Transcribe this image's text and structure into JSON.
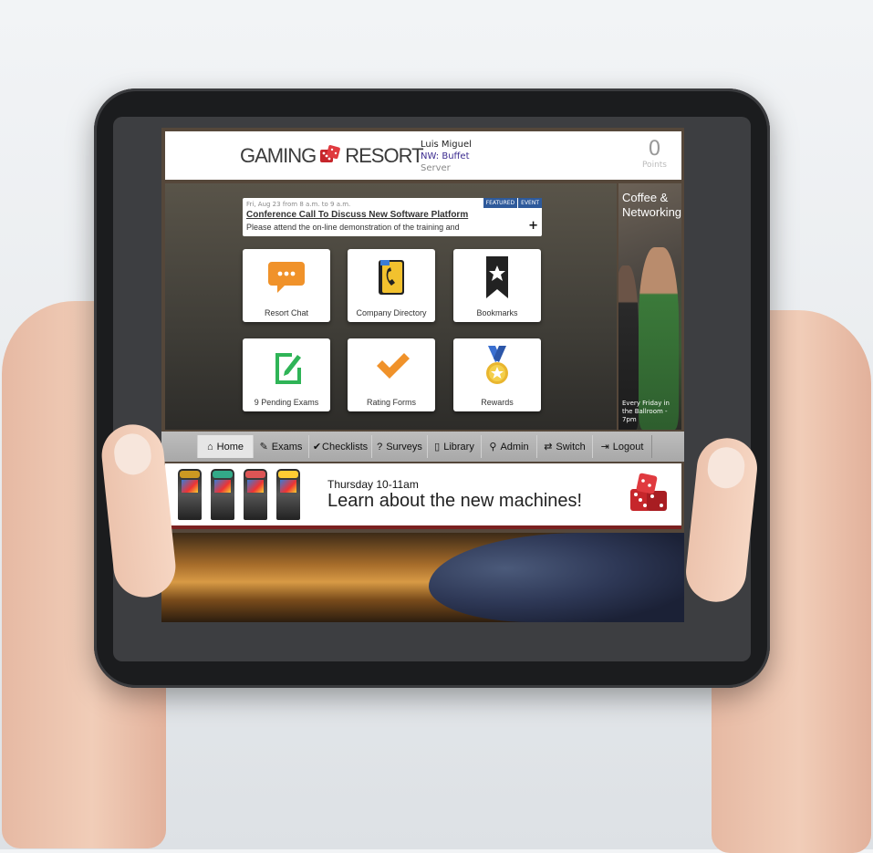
{
  "header": {
    "logo_left": "GAMING",
    "logo_right": "RESORT",
    "user_name": "Luis Miguel",
    "user_dept": "NW: Buffet",
    "user_role": "Server",
    "points_value": "0",
    "points_label": "Points"
  },
  "event": {
    "date": "Fri, Aug 23 from 8 a.m. to 9 a.m.",
    "title": "Conference Call To Discuss New Software Platform",
    "desc": "Please attend the on-line demonstration of the training and",
    "badge_featured": "FEATURED",
    "badge_event": "EVENT",
    "expand": "+"
  },
  "tiles": [
    {
      "label": "Resort Chat",
      "icon": "chat-bubble-icon"
    },
    {
      "label": "Company Directory",
      "icon": "phone-book-icon"
    },
    {
      "label": "Bookmarks",
      "icon": "bookmark-star-icon"
    },
    {
      "label": "9 Pending Exams",
      "icon": "edit-note-icon"
    },
    {
      "label": "Rating Forms",
      "icon": "checkmark-icon"
    },
    {
      "label": "Rewards",
      "icon": "medal-icon"
    }
  ],
  "promo": {
    "title": "Coffee & Networking",
    "footer": "Every Friday in the Ballroom - 7pm"
  },
  "nav": [
    {
      "label": "Home",
      "icon": "home-icon",
      "glyph": "⌂"
    },
    {
      "label": "Exams",
      "icon": "edit-icon",
      "glyph": "✎"
    },
    {
      "label": "Checklists",
      "icon": "check-icon",
      "glyph": "✔"
    },
    {
      "label": "Surveys",
      "icon": "question-icon",
      "glyph": "?"
    },
    {
      "label": "Library",
      "icon": "document-icon",
      "glyph": "▯"
    },
    {
      "label": "Admin",
      "icon": "pin-icon",
      "glyph": "⚲"
    },
    {
      "label": "Switch",
      "icon": "switch-icon",
      "glyph": "⇄"
    },
    {
      "label": "Logout",
      "icon": "logout-icon",
      "glyph": "⇥"
    }
  ],
  "banner": {
    "subtitle": "Thursday 10-11am",
    "headline": "Learn about the new machines!"
  },
  "colors": {
    "accent_blue": "#2e5a9b",
    "dice_red": "#c6262b",
    "chat_orange": "#f0922a",
    "exam_green": "#2fb457",
    "nav_gray": "#b2b2b2"
  }
}
